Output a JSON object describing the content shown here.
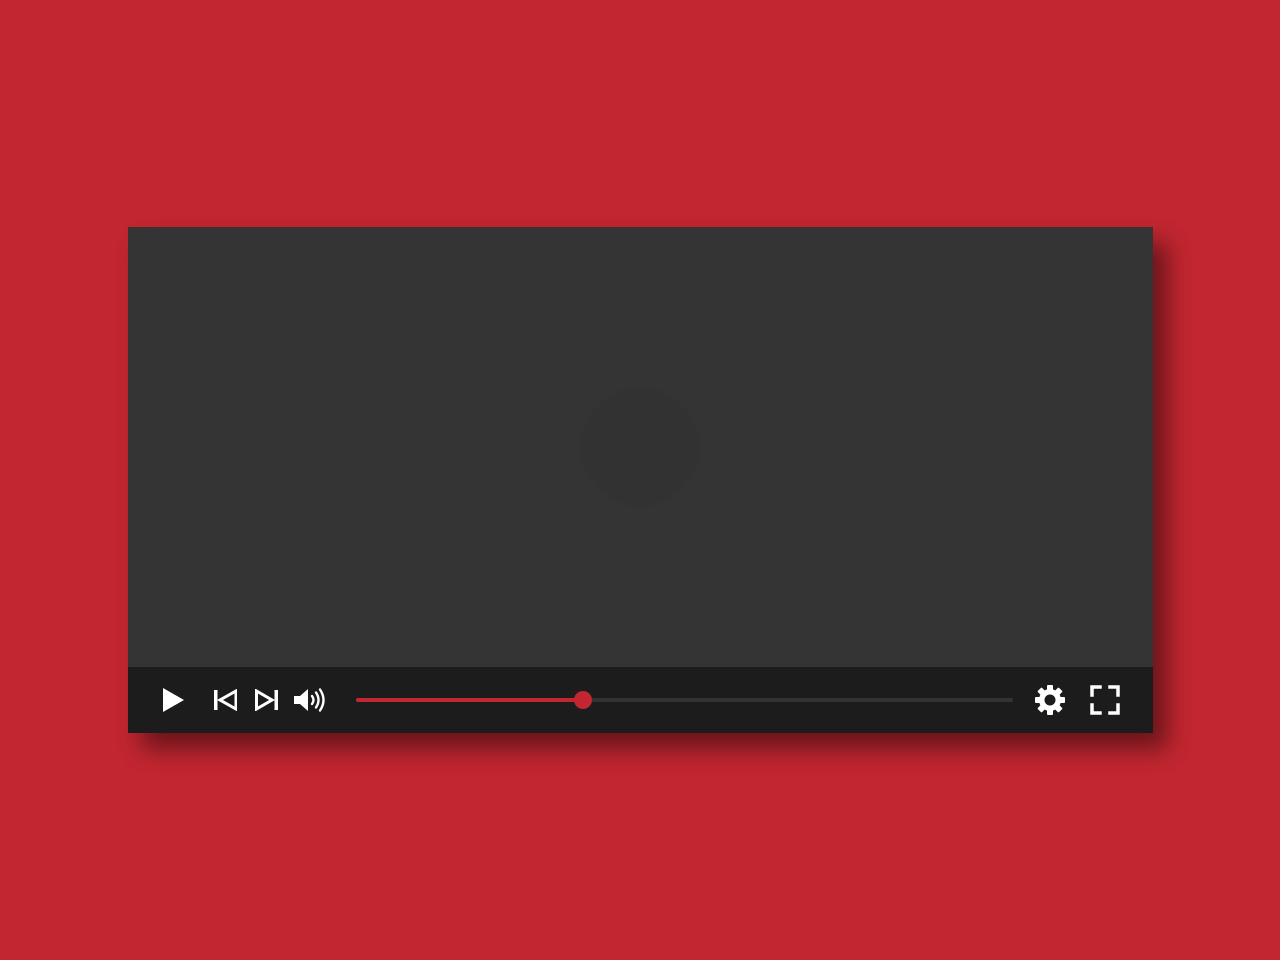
{
  "player": {
    "center_button_icon": "circle-overlay",
    "controls": {
      "play_icon": "play-icon",
      "previous_icon": "skip-previous-icon",
      "next_icon": "skip-next-icon",
      "volume_icon": "volume-icon",
      "settings_icon": "gear-icon",
      "fullscreen_icon": "fullscreen-icon"
    },
    "progress": {
      "fraction": 0.345
    }
  },
  "colors": {
    "background": "#c22630",
    "accent": "#c22630",
    "player_body": "#343434",
    "control_bar": "#1c1c1c",
    "icon": "#ffffff"
  }
}
